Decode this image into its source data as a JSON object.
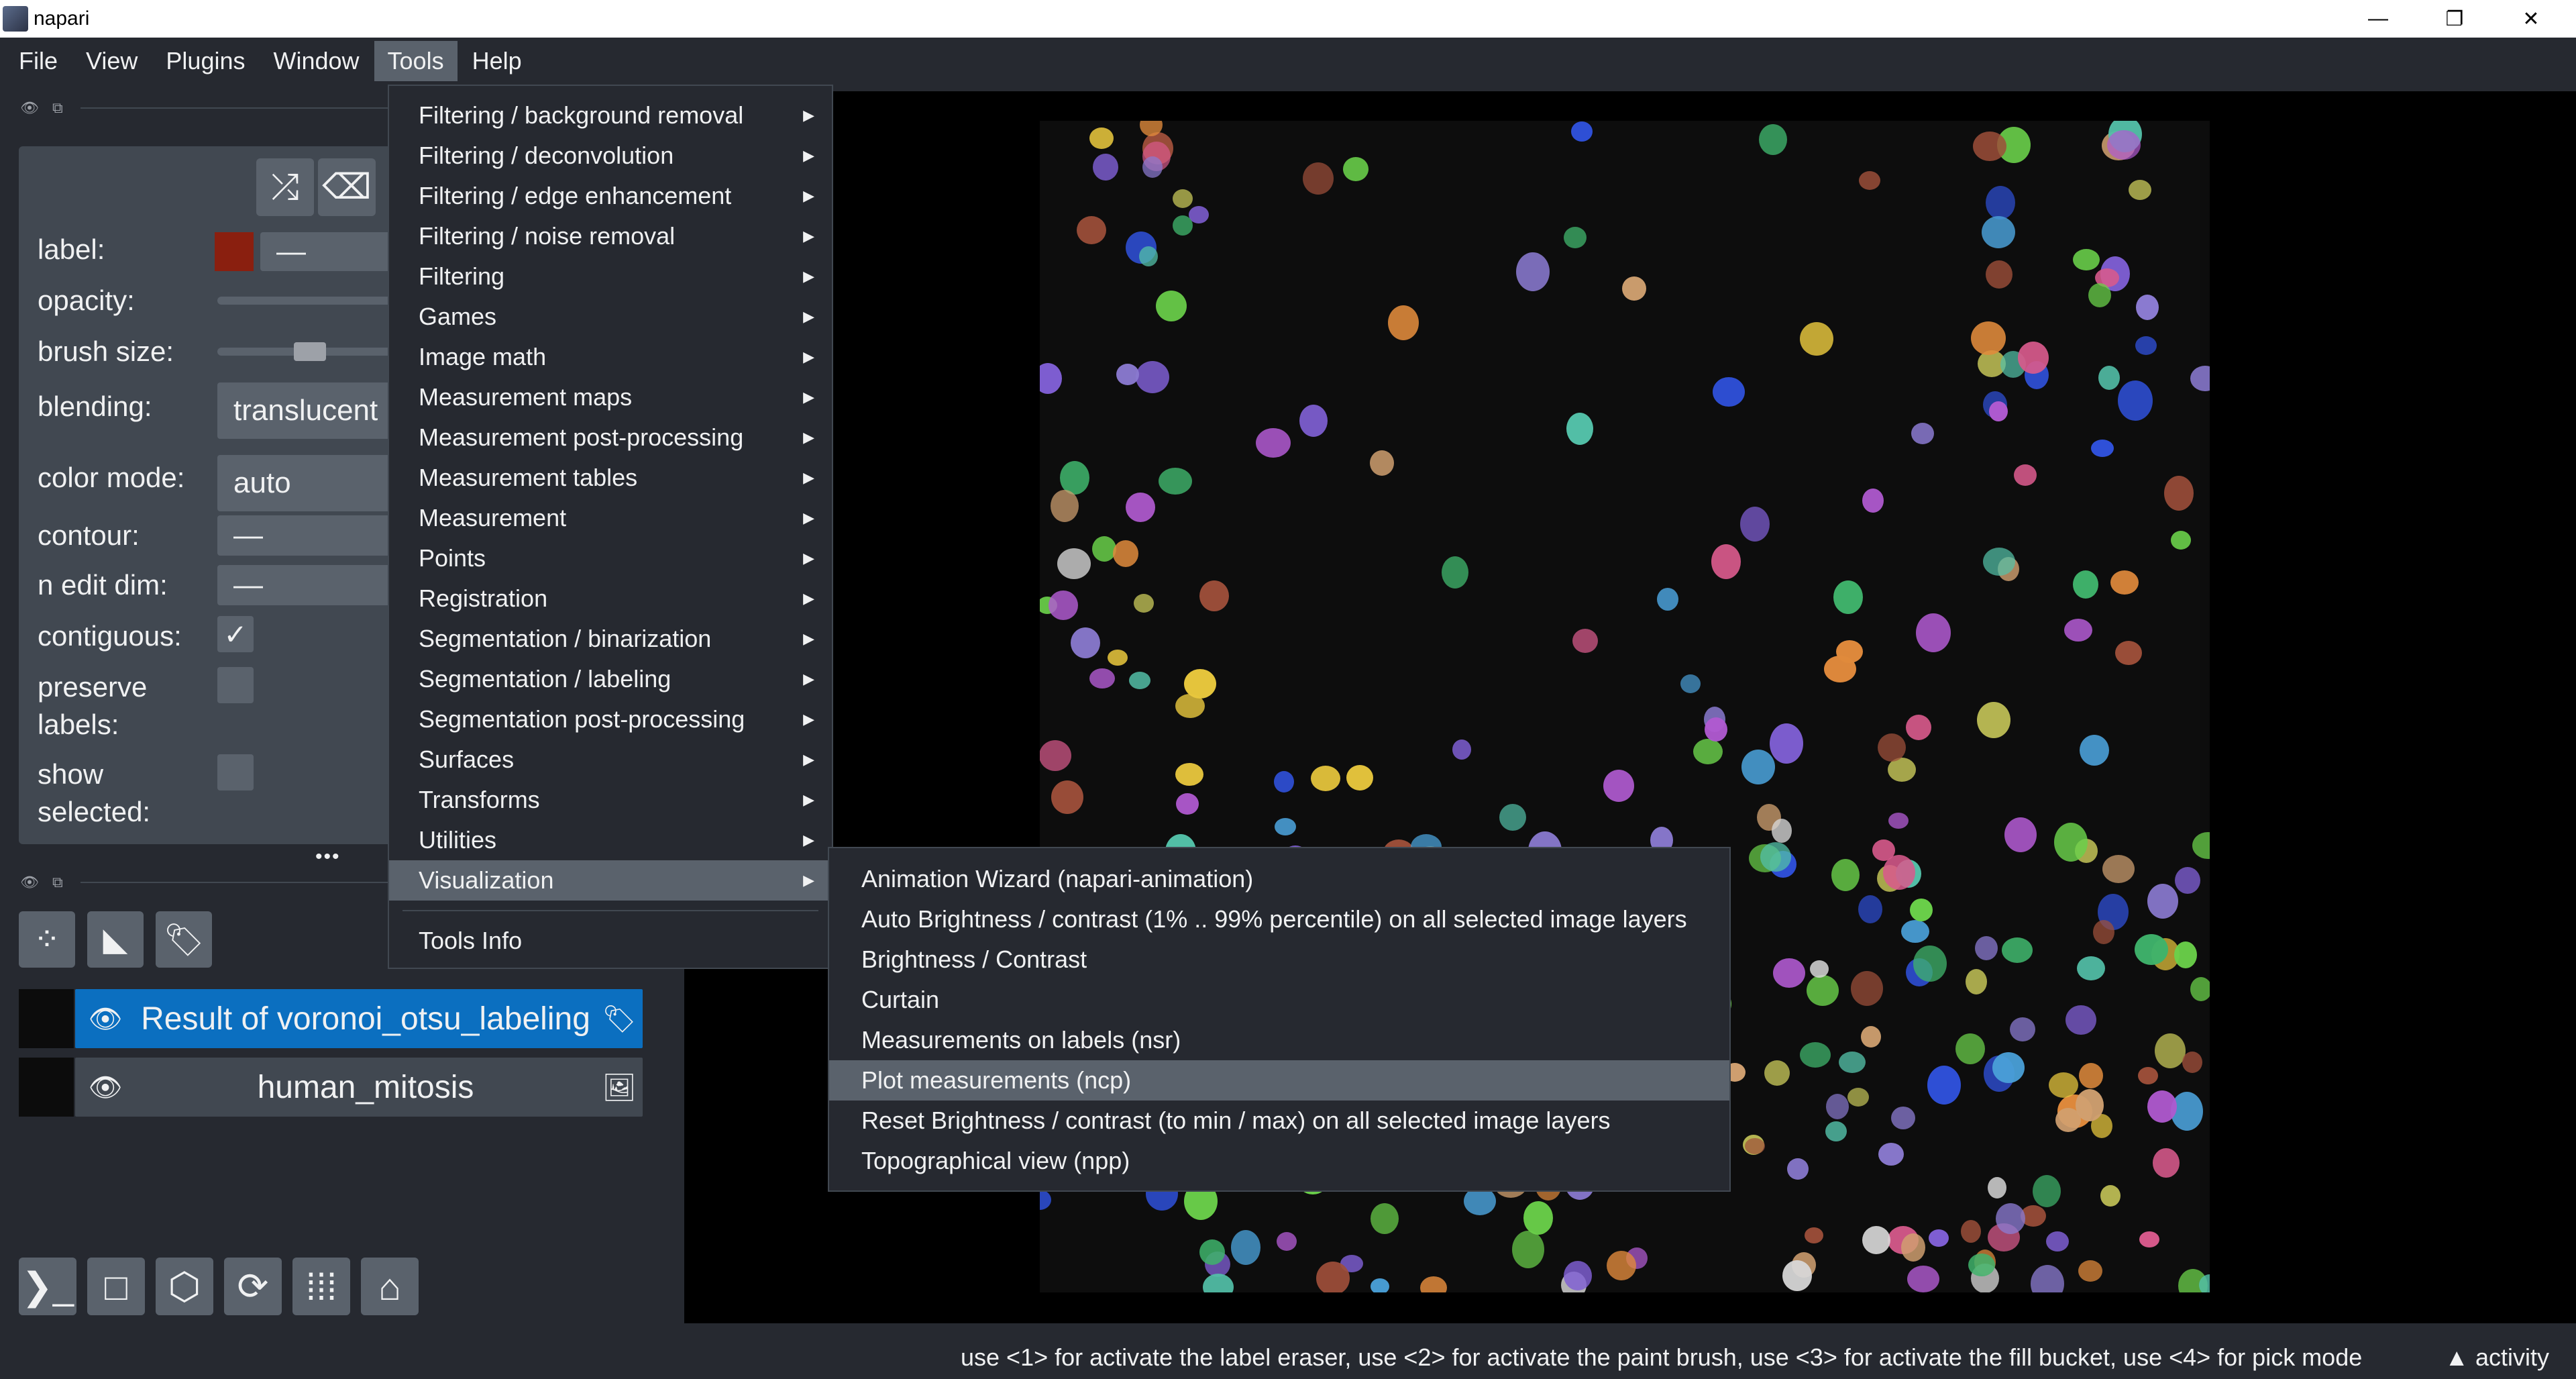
{
  "window": {
    "title": "napari",
    "controls": {
      "minimize": "—",
      "restore": "❐",
      "close": "✕"
    }
  },
  "menubar": [
    "File",
    "View",
    "Plugins",
    "Window",
    "Tools",
    "Help"
  ],
  "active_menu": "Tools",
  "layer_controls": {
    "label": "label:",
    "label_value": "—",
    "opacity": "opacity:",
    "brush_size": "brush size:",
    "blending": "blending:",
    "blending_value": "translucent",
    "color_mode": "color mode:",
    "color_mode_value": "auto",
    "contour": "contour:",
    "contour_value": "—",
    "n_edit_dim": "n edit dim:",
    "n_edit_dim_value": "—",
    "contiguous": "contiguous:",
    "contiguous_checked": true,
    "preserve_labels_1": "preserve",
    "preserve_labels_2": "labels:",
    "show_selected_1": "show",
    "show_selected_2": "selected:",
    "brush_level": 0.55,
    "more": "•••"
  },
  "layers": [
    {
      "name": "Result of voronoi_otsu_labeling",
      "selected": true,
      "type_icon": "tag-icon"
    },
    {
      "name": "human_mitosis",
      "selected": false,
      "type_icon": "image-icon"
    }
  ],
  "tools_menu": {
    "items": [
      "Filtering / background removal",
      "Filtering / deconvolution",
      "Filtering / edge enhancement",
      "Filtering / noise removal",
      "Filtering",
      "Games",
      "Image math",
      "Measurement maps",
      "Measurement post-processing",
      "Measurement tables",
      "Measurement",
      "Points",
      "Registration",
      "Segmentation / binarization",
      "Segmentation / labeling",
      "Segmentation post-processing",
      "Surfaces",
      "Transforms",
      "Utilities",
      "Visualization"
    ],
    "highlighted": "Visualization",
    "footer": "Tools Info"
  },
  "visualization_submenu": {
    "items": [
      "Animation Wizard (napari-animation)",
      "Auto Brightness / contrast (1% .. 99% percentile) on all selected image layers",
      "Brightness / Contrast",
      "Curtain",
      "Measurements on labels (nsr)",
      "Plot measurements (ncp)",
      "Reset Brightness / contrast (to min / max) on all selected image layers",
      "Topographical view (npp)"
    ],
    "highlighted": "Plot measurements (ncp)"
  },
  "statusbar": {
    "message": "use <1> for activate the label eraser, use <2> for activate the paint brush, use <3> for activate the fill bucket, use <4> for pick mode",
    "activity": "▲ activity"
  },
  "colors": {
    "background": "#262930",
    "panel": "#414851",
    "control": "#5a626c",
    "selected_layer": "#0b6fc0",
    "text": "#f0f1f2"
  }
}
